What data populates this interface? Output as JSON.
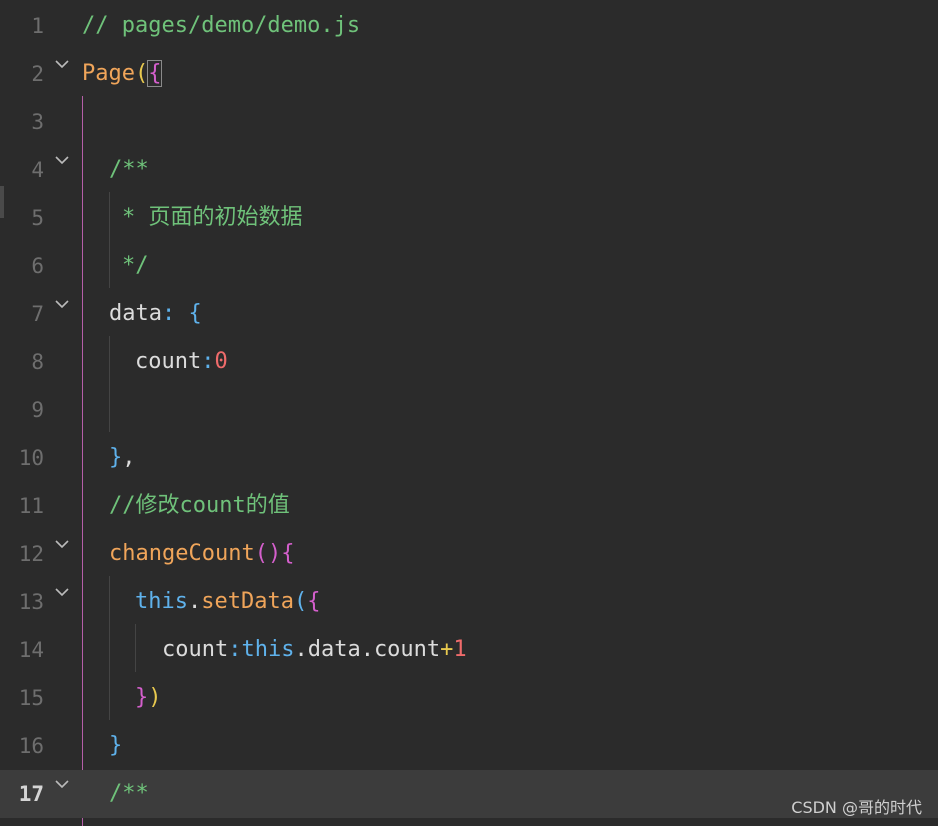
{
  "editor": {
    "lines": [
      {
        "num": "1",
        "fold": false
      },
      {
        "num": "2",
        "fold": true
      },
      {
        "num": "3",
        "fold": false
      },
      {
        "num": "4",
        "fold": true
      },
      {
        "num": "5",
        "fold": false
      },
      {
        "num": "6",
        "fold": false
      },
      {
        "num": "7",
        "fold": true
      },
      {
        "num": "8",
        "fold": false
      },
      {
        "num": "9",
        "fold": false
      },
      {
        "num": "10",
        "fold": false
      },
      {
        "num": "11",
        "fold": false
      },
      {
        "num": "12",
        "fold": true
      },
      {
        "num": "13",
        "fold": true
      },
      {
        "num": "14",
        "fold": false
      },
      {
        "num": "15",
        "fold": false
      },
      {
        "num": "16",
        "fold": false
      },
      {
        "num": "17",
        "fold": true
      }
    ],
    "code": {
      "l1": "// pages/demo/demo.js",
      "l2_func": "Page",
      "l2_paren": "(",
      "l2_brace": "{",
      "l4": "/**",
      "l5": "* 页面的初始数据",
      "l6": "*/",
      "l7_prop": "data",
      "l7_colon": ":",
      "l7_brace": "{",
      "l8_prop": "count",
      "l8_colon": ":",
      "l8_num": "0",
      "l10_brace": "}",
      "l10_comma": ",",
      "l11": "//修改count的值",
      "l12_func": "changeCount",
      "l12_parens": "()",
      "l12_brace": "{",
      "l13_this": "this",
      "l13_dot": ".",
      "l13_method": "setData",
      "l13_paren": "(",
      "l13_brace": "{",
      "l14_prop": "count",
      "l14_colon": ":",
      "l14_this": "this",
      "l14_rest": ".data.count",
      "l14_plus": "+",
      "l14_num": "1",
      "l15_brace": "}",
      "l15_paren": ")",
      "l16_brace": "}",
      "l17": "/**"
    },
    "current_line": "17"
  },
  "watermark": "CSDN @哥的时代",
  "colors": {
    "background": "#2b2b2b",
    "current_line": "#3c3c3c",
    "comment": "#6fc27a",
    "function": "#f0a55a",
    "number": "#ef6b6b",
    "keyword_this": "#5fb2ec"
  }
}
